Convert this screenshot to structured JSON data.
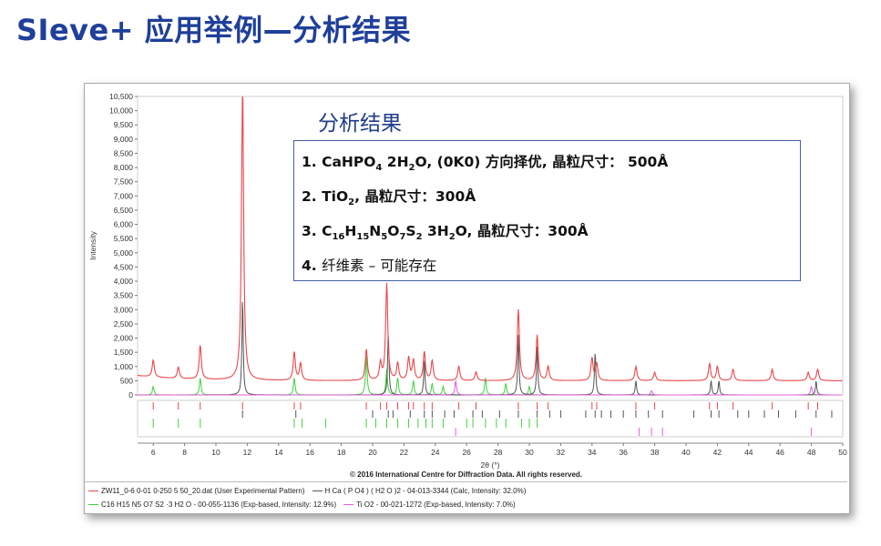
{
  "slide": {
    "title": "SIeve+ 应用举例—分析结果"
  },
  "panel": {
    "heading": "分析结果",
    "lines": [
      {
        "num": "1.",
        "parts": [
          [
            "CaHPO",
            ""
          ],
          [
            "4",
            "sub"
          ],
          [
            " 2H",
            ""
          ],
          [
            "2",
            "sub"
          ],
          [
            "O, (0K0) 方向择优,  晶粒尺寸：  500Å",
            ""
          ]
        ]
      },
      {
        "num": "2.",
        "parts": [
          [
            "TiO",
            ""
          ],
          [
            "2",
            "sub"
          ],
          [
            ", 晶粒尺寸：300Å",
            ""
          ]
        ]
      },
      {
        "num": "3.",
        "parts": [
          [
            "C",
            ""
          ],
          [
            "16",
            "sub"
          ],
          [
            "H",
            ""
          ],
          [
            "15",
            "sub"
          ],
          [
            "N",
            ""
          ],
          [
            "5",
            "sub"
          ],
          [
            "O",
            ""
          ],
          [
            "7",
            "sub"
          ],
          [
            "S",
            ""
          ],
          [
            "2",
            "sub"
          ],
          [
            " 3H",
            ""
          ],
          [
            "2",
            "sub"
          ],
          [
            "O, 晶粒尺寸：300Å",
            ""
          ]
        ]
      },
      {
        "num": "4.",
        "parts": [
          [
            "纤维素 ",
            ""
          ],
          [
            "–",
            ""
          ],
          [
            " 可能存在",
            ""
          ]
        ]
      }
    ]
  },
  "chart_data": {
    "type": "line",
    "xlabel": "2θ (°)",
    "ylabel": "Intensity",
    "xlim": [
      5,
      50
    ],
    "ylim": [
      0,
      10500
    ],
    "xticks": [
      6,
      8,
      10,
      12,
      14,
      16,
      18,
      20,
      22,
      24,
      26,
      28,
      30,
      32,
      34,
      36,
      38,
      40,
      42,
      44,
      46,
      48,
      50
    ],
    "yticks": [
      0,
      500,
      1000,
      1500,
      2000,
      2500,
      3000,
      3500,
      4000,
      4500,
      5000,
      5500,
      6000,
      6500,
      7000,
      7500,
      8000,
      8500,
      9000,
      9500,
      10000,
      10500
    ],
    "ytick_labels": [
      "0",
      "500",
      "1,000",
      "1,500",
      "2,000",
      "2,500",
      "3,000",
      "3,500",
      "4,000",
      "4,500",
      "5,000",
      "5,500",
      "6,000",
      "6,500",
      "7,000",
      "7,500",
      "8,000",
      "8,500",
      "9,000",
      "9,500",
      "10,000",
      "10,500"
    ],
    "baseline": 500,
    "colors": {
      "experimental": "#e8474a",
      "hca": "#555555",
      "c16": "#3fd13f",
      "tio2": "#e35ee3"
    },
    "experimental_peaks": [
      [
        6.0,
        600
      ],
      [
        7.6,
        400
      ],
      [
        9.0,
        1200
      ],
      [
        11.7,
        10500
      ],
      [
        15.0,
        1000
      ],
      [
        15.4,
        600
      ],
      [
        19.6,
        1100
      ],
      [
        20.5,
        600
      ],
      [
        20.9,
        3400
      ],
      [
        21.6,
        600
      ],
      [
        22.3,
        800
      ],
      [
        22.6,
        700
      ],
      [
        23.3,
        1000
      ],
      [
        23.8,
        700
      ],
      [
        25.5,
        500
      ],
      [
        26.6,
        300
      ],
      [
        29.3,
        2500
      ],
      [
        30.5,
        1600
      ],
      [
        31.2,
        500
      ],
      [
        34.0,
        800
      ],
      [
        34.3,
        600
      ],
      [
        36.8,
        500
      ],
      [
        38.0,
        300
      ],
      [
        41.5,
        600
      ],
      [
        42.0,
        500
      ],
      [
        43.0,
        400
      ],
      [
        45.5,
        400
      ],
      [
        47.8,
        300
      ],
      [
        48.4,
        400
      ]
    ],
    "hca_peaks": [
      [
        11.7,
        3400
      ],
      [
        21.0,
        2200
      ],
      [
        23.3,
        1200
      ],
      [
        29.3,
        2100
      ],
      [
        30.5,
        1700
      ],
      [
        34.2,
        1500
      ],
      [
        36.8,
        500
      ],
      [
        41.6,
        500
      ],
      [
        42.1,
        500
      ],
      [
        48.3,
        500
      ]
    ],
    "c16_peaks": [
      [
        6.0,
        300
      ],
      [
        9.0,
        600
      ],
      [
        15.0,
        600
      ],
      [
        19.6,
        1400
      ],
      [
        20.9,
        900
      ],
      [
        21.6,
        600
      ],
      [
        22.6,
        500
      ],
      [
        23.8,
        400
      ],
      [
        24.5,
        300
      ],
      [
        27.2,
        600
      ],
      [
        28.5,
        400
      ],
      [
        30.0,
        300
      ]
    ],
    "tio2_peaks": [
      [
        25.3,
        500
      ],
      [
        37.8,
        150
      ],
      [
        48.0,
        300
      ]
    ],
    "tick_rows": {
      "experimental": [
        6.0,
        7.6,
        9.0,
        11.7,
        15.0,
        15.4,
        19.6,
        20.5,
        20.9,
        21.6,
        22.3,
        22.6,
        23.3,
        23.8,
        25.5,
        26.6,
        29.3,
        30.5,
        31.2,
        34.0,
        34.3,
        36.8,
        38.0,
        41.5,
        42.0,
        43.0,
        45.5,
        47.8,
        48.4
      ],
      "hca": [
        11.7,
        15.1,
        20.0,
        21.0,
        21.3,
        22.4,
        23.3,
        23.8,
        24.6,
        25.2,
        26.4,
        27.0,
        28.1,
        29.3,
        30.5,
        31.3,
        32.0,
        33.6,
        34.2,
        34.6,
        35.2,
        36.0,
        36.8,
        37.6,
        38.5,
        40.5,
        41.6,
        42.1,
        43.3,
        44.0,
        45.0,
        45.9,
        47.0,
        48.3,
        49.3
      ],
      "c16": [
        6.0,
        7.6,
        9.0,
        15.0,
        15.5,
        17.0,
        19.6,
        20.2,
        20.9,
        21.6,
        22.3,
        22.9,
        23.4,
        23.8,
        24.5,
        26.0,
        26.4,
        27.2,
        27.9,
        28.5,
        29.5,
        30.0,
        30.5
      ],
      "tio2": [
        25.3,
        37.0,
        37.8,
        38.5,
        48.0
      ]
    },
    "legend": [
      {
        "key": "experimental",
        "label": "ZW11_0-6 0-01 0-250 5 50_20.dat (User Experimental Pattern)"
      },
      {
        "key": "hca",
        "label": "H Ca ( P O4 ) ( H2 O )2 - 04-013-3344 (Calc, Intensity: 32.0%)"
      },
      {
        "key": "c16",
        "label": "C16 H15 N5 O7 S2 ·3 H2 O - 00-055-1136 (Exp-based, Intensity: 12.9%)"
      },
      {
        "key": "tio2",
        "label": "Ti O2 - 00-021-1272 (Exp-based, Intensity: 7.0%)"
      }
    ],
    "copyright": "© 2016 International Centre for Diffraction Data. All rights reserved."
  }
}
